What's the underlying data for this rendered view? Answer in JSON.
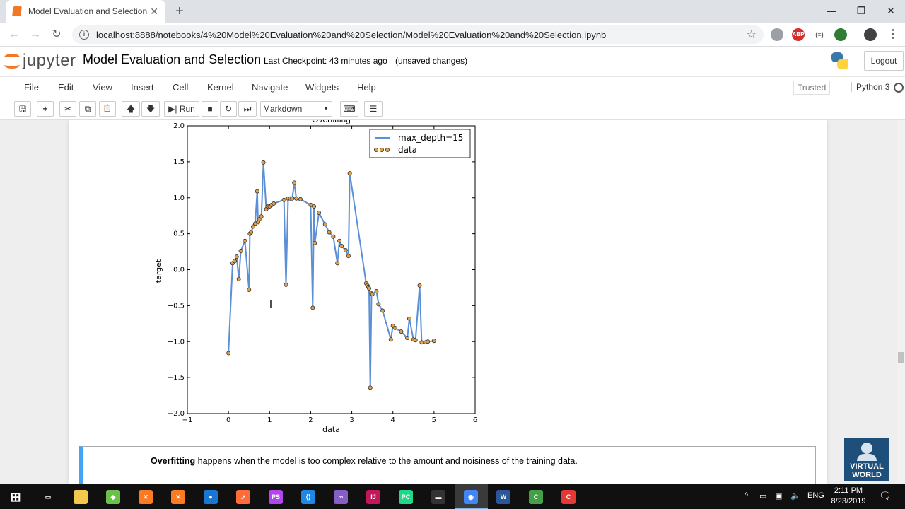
{
  "browser": {
    "tab_title": "Model Evaluation and Selection",
    "tab_close": "✕",
    "new_tab": "+",
    "url": "localhost:8888/notebooks/4%20Model%20Evaluation%20and%20Selection/Model%20Evaluation%20and%20Selection.ipynb",
    "window_controls": {
      "minimize": "—",
      "restore": "❐",
      "close": "✕"
    },
    "extensions": [
      {
        "name": "shield-extension-icon",
        "label": "",
        "color": "#9aa0a6"
      },
      {
        "name": "adblock-extension-icon",
        "label": "ABP",
        "color": "#d32f2f"
      },
      {
        "name": "json-extension-icon",
        "label": "{≡}",
        "color": "#5f6368"
      },
      {
        "name": "globe-extension-icon",
        "label": "",
        "color": "#2e7d32"
      },
      {
        "name": "profile-avatar-icon",
        "label": "",
        "color": "#424242"
      }
    ]
  },
  "jupyter": {
    "logo_text": "jupyter",
    "notebook_title": "Model Evaluation and Selection",
    "checkpoint": "Last Checkpoint: 43 minutes ago",
    "unsaved": "(unsaved changes)",
    "logout_label": "Logout",
    "menus": [
      "File",
      "Edit",
      "View",
      "Insert",
      "Cell",
      "Kernel",
      "Navigate",
      "Widgets",
      "Help"
    ],
    "trusted_label": "Trusted",
    "kernel_name": "Python 3",
    "toolbar": {
      "save_icon": "🖫",
      "add_icon": "+",
      "cut_icon": "✂",
      "copy_icon": "⧉",
      "paste_icon": "📋",
      "up_icon": "🡅",
      "down_icon": "🡇",
      "run_label": "▶| Run",
      "stop_icon": "■",
      "restart_icon": "↻",
      "fastforward_icon": "⏭",
      "cell_type": "Markdown",
      "keyboard_icon": "⌨",
      "list_icon": "☰"
    }
  },
  "chart_data": {
    "type": "line",
    "title": "Overfitting",
    "xlabel": "data",
    "ylabel": "target",
    "xlim": [
      -1,
      6
    ],
    "ylim": [
      -2.0,
      2.0
    ],
    "xticks": [
      "−1",
      "0",
      "1",
      "2",
      "3",
      "4",
      "5",
      "6"
    ],
    "yticks": [
      "2.0",
      "1.5",
      "1.0",
      "0.5",
      "0.0",
      "−0.5",
      "−1.0",
      "−1.5",
      "−2.0"
    ],
    "legend_position": "top-right",
    "grid": false,
    "series": [
      {
        "name": "max_depth=15",
        "kind": "line",
        "color": "#5b8fd6",
        "x": [
          0.0,
          0.1,
          0.15,
          0.2,
          0.25,
          0.3,
          0.4,
          0.5,
          0.52,
          0.55,
          0.6,
          0.65,
          0.7,
          0.72,
          0.75,
          0.8,
          0.85,
          0.92,
          0.95,
          1.0,
          1.05,
          1.1,
          1.35,
          1.4,
          1.45,
          1.5,
          1.55,
          1.6,
          1.65,
          1.75,
          2.0,
          2.05,
          2.08,
          2.1,
          2.2,
          2.35,
          2.45,
          2.55,
          2.65,
          2.7,
          2.75,
          2.85,
          2.92,
          2.95,
          3.35,
          3.38,
          3.4,
          3.42,
          3.45,
          3.48,
          3.5,
          3.6,
          3.65,
          3.75,
          3.95,
          4.0,
          4.05,
          4.2,
          4.35,
          4.4,
          4.5,
          4.55,
          4.65,
          4.7,
          4.8,
          4.85,
          5.0
        ],
        "y": [
          -1.16,
          0.09,
          0.12,
          0.18,
          -0.13,
          0.26,
          0.4,
          -0.28,
          0.5,
          0.52,
          0.6,
          0.64,
          1.09,
          0.66,
          0.7,
          0.74,
          1.49,
          0.84,
          0.88,
          0.88,
          0.9,
          0.92,
          0.97,
          -0.21,
          0.99,
          0.99,
          0.99,
          1.21,
          0.99,
          0.98,
          0.9,
          -0.53,
          0.88,
          0.37,
          0.79,
          0.63,
          0.52,
          0.46,
          0.09,
          0.4,
          0.33,
          0.27,
          0.19,
          1.34,
          -0.19,
          -0.22,
          -0.24,
          -0.26,
          -1.64,
          -0.33,
          -0.34,
          -0.3,
          -0.48,
          -0.57,
          -0.97,
          -0.78,
          -0.81,
          -0.86,
          -0.95,
          -0.68,
          -0.97,
          -0.98,
          -0.22,
          -1.01,
          -1.01,
          -1.0,
          -0.99
        ]
      },
      {
        "name": "data",
        "kind": "scatter",
        "color": "#e0a04c",
        "x": [
          0.0,
          0.1,
          0.15,
          0.2,
          0.25,
          0.3,
          0.4,
          0.5,
          0.52,
          0.55,
          0.6,
          0.65,
          0.7,
          0.72,
          0.75,
          0.8,
          0.85,
          0.92,
          0.95,
          1.0,
          1.05,
          1.1,
          1.35,
          1.4,
          1.45,
          1.5,
          1.55,
          1.6,
          1.65,
          1.75,
          2.0,
          2.05,
          2.08,
          2.1,
          2.2,
          2.35,
          2.45,
          2.55,
          2.65,
          2.7,
          2.75,
          2.85,
          2.92,
          2.95,
          3.35,
          3.38,
          3.4,
          3.42,
          3.45,
          3.48,
          3.5,
          3.6,
          3.65,
          3.75,
          3.95,
          4.0,
          4.05,
          4.2,
          4.35,
          4.4,
          4.5,
          4.55,
          4.65,
          4.7,
          4.8,
          4.85,
          5.0
        ],
        "y": [
          -1.16,
          0.09,
          0.12,
          0.18,
          -0.13,
          0.26,
          0.4,
          -0.28,
          0.5,
          0.52,
          0.6,
          0.64,
          1.09,
          0.66,
          0.7,
          0.74,
          1.49,
          0.84,
          0.88,
          0.88,
          0.9,
          0.92,
          0.97,
          -0.21,
          0.99,
          0.99,
          0.99,
          1.21,
          0.99,
          0.98,
          0.9,
          -0.53,
          0.88,
          0.37,
          0.79,
          0.63,
          0.52,
          0.46,
          0.09,
          0.4,
          0.33,
          0.27,
          0.19,
          1.34,
          -0.19,
          -0.22,
          -0.24,
          -0.26,
          -1.64,
          -0.33,
          -0.34,
          -0.3,
          -0.48,
          -0.57,
          -0.97,
          -0.78,
          -0.81,
          -0.86,
          -0.95,
          -0.68,
          -0.97,
          -0.98,
          -0.22,
          -1.01,
          -1.01,
          -1.0,
          -0.99
        ]
      }
    ]
  },
  "markdown": {
    "bold_word": "Overfitting",
    "rest": " happens when the model is too complex relative to the amount and noisiness of the training data."
  },
  "virtual_world": {
    "line1": "VIRTUAL",
    "line2": "WORLD"
  },
  "taskbar": {
    "start_icon": "⊞",
    "apps": [
      {
        "name": "task-view-icon",
        "label": "▭",
        "color": "#101010"
      },
      {
        "name": "file-explorer-icon",
        "label": "",
        "color": "#f2c94c"
      },
      {
        "name": "git-icon",
        "label": "◆",
        "color": "#6cc04a"
      },
      {
        "name": "xampp-icon-1",
        "label": "✕",
        "color": "#fb7a24"
      },
      {
        "name": "xampp-icon-2",
        "label": "✕",
        "color": "#fb7a24"
      },
      {
        "name": "maps-icon",
        "label": "●",
        "color": "#1976d2"
      },
      {
        "name": "postman-icon",
        "label": "➚",
        "color": "#ff6c37"
      },
      {
        "name": "phpstorm-icon",
        "label": "PS",
        "color": "#b345f1"
      },
      {
        "name": "vscode-icon",
        "label": "⟨⟩",
        "color": "#1f88e5"
      },
      {
        "name": "visual-studio-icon",
        "label": "∞",
        "color": "#865fc5"
      },
      {
        "name": "intellij-icon",
        "label": "IJ",
        "color": "#c2185b"
      },
      {
        "name": "pycharm-icon",
        "label": "PC",
        "color": "#21d789"
      },
      {
        "name": "terminal-icon",
        "label": "▬",
        "color": "#333333"
      },
      {
        "name": "chrome-icon",
        "label": "◉",
        "color": "#4285f4"
      },
      {
        "name": "word-icon",
        "label": "W",
        "color": "#2b579a"
      },
      {
        "name": "camtasia-icon-green",
        "label": "C",
        "color": "#43a047"
      },
      {
        "name": "camtasia-icon-red",
        "label": "C",
        "color": "#e53935"
      }
    ],
    "tray_chevron": "^",
    "tray_language": "ENG",
    "clock_time": "2:11 PM",
    "clock_date": "8/23/2019"
  }
}
